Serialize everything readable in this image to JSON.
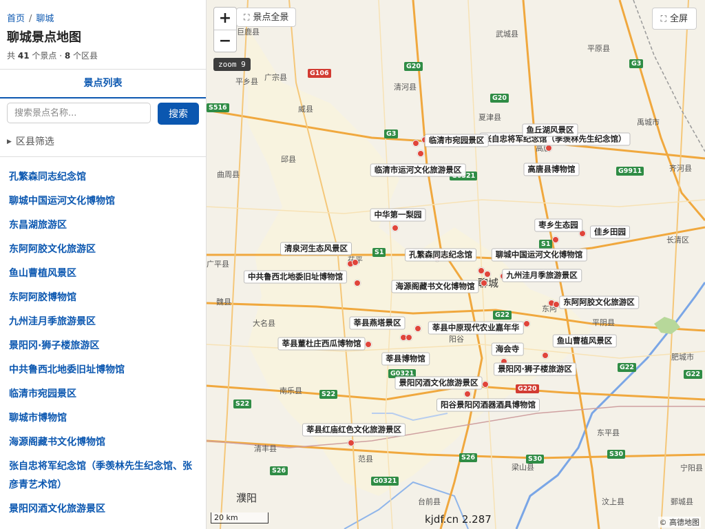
{
  "breadcrumb": {
    "home": "首页",
    "sep": "/",
    "current": "聊城"
  },
  "page_title": "聊城景点地图",
  "stats": {
    "prefix": "共",
    "spots": "41",
    "spots_unit": "个景点 ·",
    "districts": "8",
    "districts_unit": "个区县"
  },
  "tab": {
    "label": "景点列表"
  },
  "search": {
    "placeholder": "搜索景点名称...",
    "button": "搜索"
  },
  "filter": {
    "label": "区县筛选"
  },
  "list_items": [
    "孔繁森同志纪念馆",
    "聊城中国运河文化博物馆",
    "东昌湖旅游区",
    "东阿阿胶文化旅游区",
    "鱼山曹植风景区",
    "东阿阿胶博物馆",
    "九州洼月季旅游景区",
    "景阳冈·狮子楼旅游区",
    "中共鲁西北地委旧址博物馆",
    "临清市宛园景区",
    "聊城市博物馆",
    "海源阁藏书文化博物馆",
    "张自忠将军纪念馆（季羡林先生纪念馆、张彦青艺术馆）",
    "景阳冈酒文化旅游景区"
  ],
  "map": {
    "zoom_in": "+",
    "zoom_out": "−",
    "zoom_label": "zoom 9",
    "overview_button": "景点全景",
    "fullscreen_button": "全屏",
    "scale": "20 km",
    "watermark": "kjdf.cn 2.287",
    "copyright": "© 高德地图",
    "poi_color": "#e0453a",
    "accent_color": "#0b57b0"
  },
  "poi_labels": [
    "张自忠将军纪念馆（季羡林先生纪念馆）",
    "临清市宛园景区",
    "鱼丘湖风景区",
    "临清市运河文化旅游景区",
    "高唐县博物馆",
    "中华第一梨园",
    "枣乡生态园",
    "佳乡田园",
    "清泉河生态风景区",
    "孔繁森同志纪念馆",
    "聊城中国运河文化博物馆",
    "中共鲁西北地委旧址博物馆",
    "九州洼月季旅游景区",
    "海源阁藏书文化博物馆",
    "东阿阿胶文化旅游区",
    "莘县燕塔景区",
    "莘县中原现代农业嘉年华",
    "莘县董杜庄西瓜博物馆",
    "鱼山曹植风景区",
    "海会寺",
    "莘县博物馆",
    "景阳冈·狮子楼旅游区",
    "景阳冈酒文化旅游景区",
    "阳谷景阳冈酒器酒具博物馆",
    "莘县红庙红色文化旅游景区"
  ],
  "places": [
    "巨鹿县",
    "武城县",
    "平原县",
    "平乡县",
    "广宗县",
    "清河县",
    "威县",
    "夏津县",
    "禹城市",
    "邱县",
    "高唐",
    "齐河县",
    "曲周县",
    "茌平",
    "冠县",
    "长清区",
    "广平县",
    "聊城",
    "魏县",
    "东阿",
    "大名县",
    "阳谷",
    "平阴县",
    "莘县",
    "肥城市",
    "南乐县",
    "东平县",
    "清丰县",
    "范县",
    "梁山县",
    "宁阳县",
    "濮阳",
    "台前县",
    "汶上县",
    "鄄城县"
  ],
  "road_shields": [
    "G106",
    "G20",
    "G20",
    "G3",
    "S516",
    "G3",
    "G0321",
    "G9911",
    "S1",
    "S1",
    "G22",
    "G22",
    "G0321",
    "G220",
    "S22",
    "S22",
    "S26",
    "G0321",
    "S26",
    "S30",
    "S30",
    "G22"
  ]
}
